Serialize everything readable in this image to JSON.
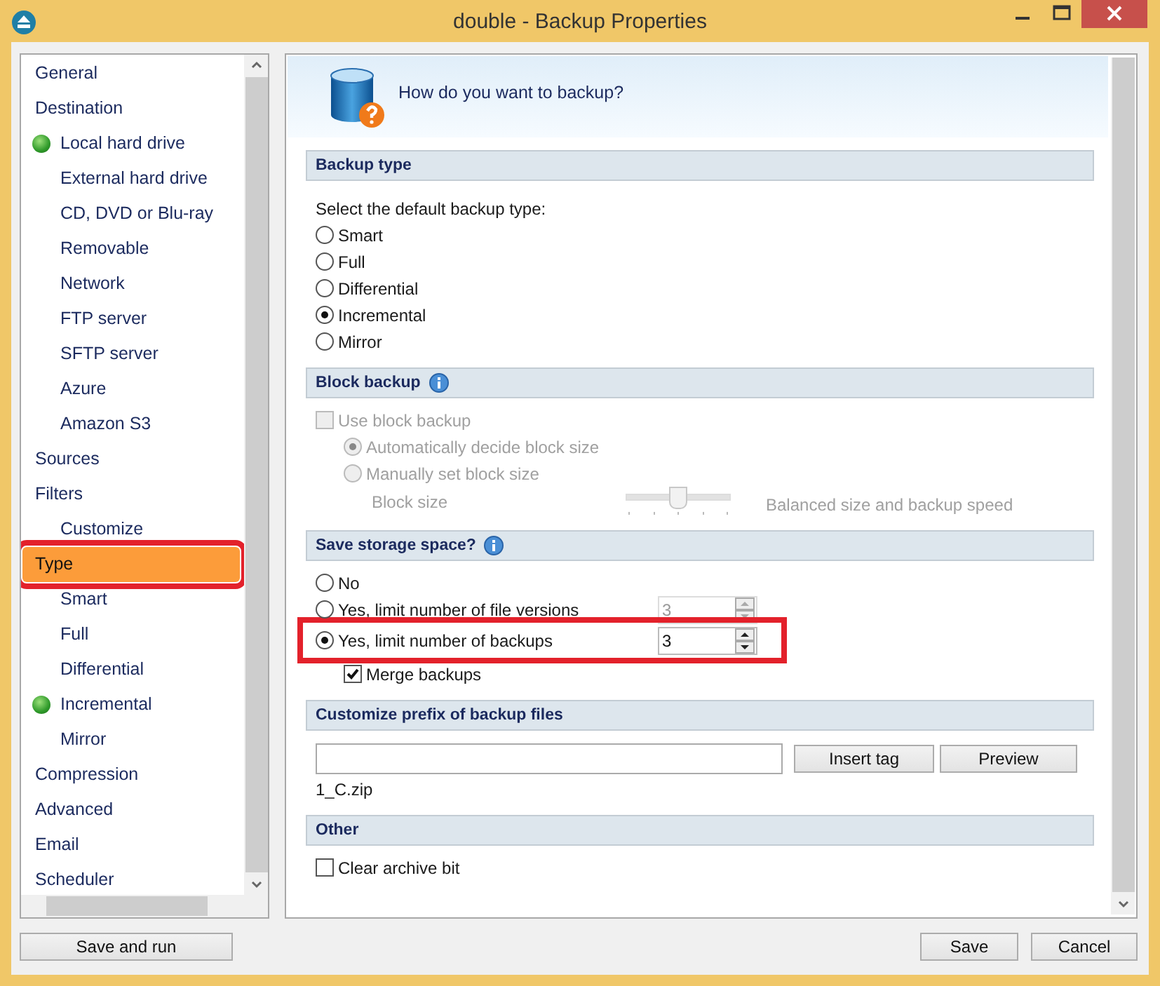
{
  "window": {
    "title": "double - Backup Properties"
  },
  "sidebar": {
    "items": [
      {
        "label": "General",
        "selected": false,
        "highlighted": false
      },
      {
        "label": "Destination",
        "selected": false,
        "highlighted": false,
        "children": [
          {
            "label": "Local hard drive",
            "selected": false,
            "highlighted": false,
            "active": true
          },
          {
            "label": "External hard drive",
            "selected": false,
            "highlighted": false,
            "active": false
          },
          {
            "label": "CD, DVD or Blu-ray",
            "selected": false,
            "highlighted": false,
            "active": false
          },
          {
            "label": "Removable",
            "selected": false,
            "highlighted": false,
            "active": false
          },
          {
            "label": "Network",
            "selected": false,
            "highlighted": false,
            "active": false
          },
          {
            "label": "FTP server",
            "selected": false,
            "highlighted": false,
            "active": false
          },
          {
            "label": "SFTP server",
            "selected": false,
            "highlighted": false,
            "active": false
          },
          {
            "label": "Azure",
            "selected": false,
            "highlighted": false,
            "active": false
          },
          {
            "label": "Amazon S3",
            "selected": false,
            "highlighted": false,
            "active": false
          }
        ]
      },
      {
        "label": "Sources",
        "selected": false,
        "highlighted": false
      },
      {
        "label": "Filters",
        "selected": false,
        "highlighted": false,
        "children": [
          {
            "label": "Customize",
            "selected": false,
            "highlighted": false,
            "active": false
          }
        ]
      },
      {
        "label": "Type",
        "selected": true,
        "highlighted": true,
        "children": [
          {
            "label": "Smart",
            "selected": false,
            "highlighted": false,
            "active": false
          },
          {
            "label": "Full",
            "selected": false,
            "highlighted": false,
            "active": false
          },
          {
            "label": "Differential",
            "selected": false,
            "highlighted": false,
            "active": false
          },
          {
            "label": "Incremental",
            "selected": false,
            "highlighted": false,
            "active": true
          },
          {
            "label": "Mirror",
            "selected": false,
            "highlighted": false,
            "active": false
          }
        ]
      },
      {
        "label": "Compression",
        "selected": false,
        "highlighted": false
      },
      {
        "label": "Advanced",
        "selected": false,
        "highlighted": false
      },
      {
        "label": "Email",
        "selected": false,
        "highlighted": false
      },
      {
        "label": "Scheduler",
        "selected": false,
        "highlighted": false
      }
    ]
  },
  "header": {
    "title": "How do you want to backup?"
  },
  "sections": [
    {
      "title": "Backup type",
      "info": false,
      "rows": [
        {
          "kind": "text",
          "text": "Select the default backup type:"
        },
        {
          "kind": "radio",
          "label": "Smart",
          "selected": false,
          "disabled": false
        },
        {
          "kind": "radio",
          "label": "Full",
          "selected": false,
          "disabled": false
        },
        {
          "kind": "radio",
          "label": "Differential",
          "selected": false,
          "disabled": false
        },
        {
          "kind": "radio",
          "label": "Incremental",
          "selected": true,
          "disabled": false
        },
        {
          "kind": "radio",
          "label": "Mirror",
          "selected": false,
          "disabled": false
        }
      ]
    },
    {
      "title": "Block backup",
      "info": true,
      "rows": [
        {
          "kind": "checkbox",
          "label": "Use block backup",
          "checked": false,
          "disabled": true,
          "children": [
            {
              "kind": "radio",
              "label": "Automatically decide block size",
              "selected": true,
              "disabled": true
            },
            {
              "kind": "radio",
              "label": "Manually set block size",
              "selected": false,
              "disabled": true
            },
            {
              "kind": "slider",
              "label": "Block size",
              "level": 0.5,
              "reading": "Balanced size and backup speed",
              "disabled": true
            }
          ]
        }
      ]
    },
    {
      "title": "Save storage space?",
      "info": true,
      "rows": [
        {
          "kind": "radio",
          "label": "No",
          "selected": false,
          "disabled": false
        },
        {
          "kind": "radio",
          "label": "Yes, limit number of file versions",
          "selected": false,
          "disabled": false,
          "spin": {
            "value": "3",
            "disabled": true
          }
        },
        {
          "kind": "radio",
          "label": "Yes, limit number of backups",
          "selected": true,
          "disabled": false,
          "highlighted": true,
          "spin": {
            "value": "3",
            "disabled": false
          },
          "children": [
            {
              "kind": "checkbox",
              "label": "Merge backups",
              "checked": true,
              "disabled": false
            }
          ]
        }
      ]
    },
    {
      "title": "Customize prefix of backup files",
      "info": false,
      "rows": [
        {
          "kind": "field",
          "buttons": [
            "Insert tag",
            "Preview"
          ]
        },
        {
          "kind": "text",
          "text": "1_C.zip"
        }
      ]
    },
    {
      "title": "Other",
      "info": false,
      "rows": [
        {
          "kind": "checkbox",
          "label": "Clear archive bit",
          "checked": false,
          "disabled": false
        }
      ]
    }
  ],
  "footer": {
    "left_button": "Save and run",
    "buttons": [
      "Save",
      "Cancel"
    ]
  }
}
